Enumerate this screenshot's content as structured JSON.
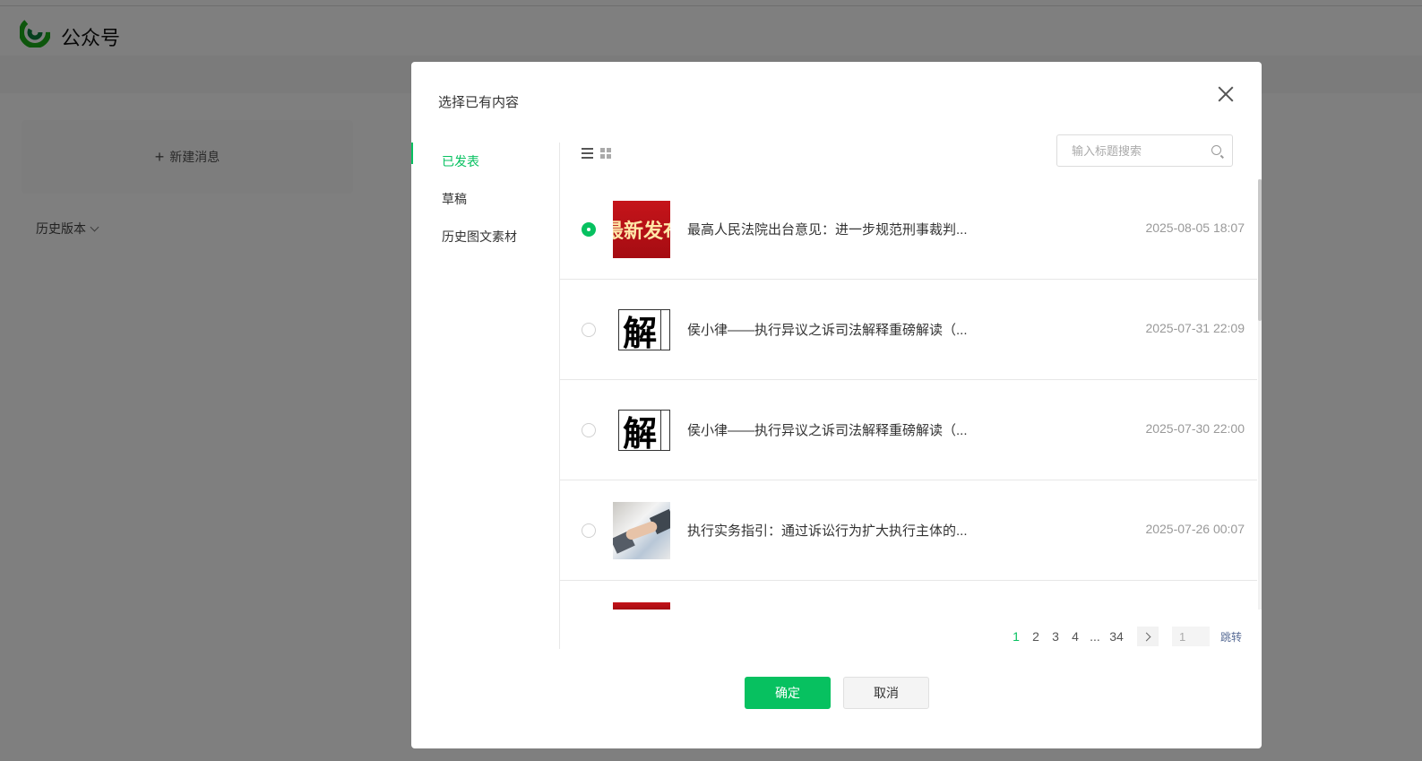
{
  "app": {
    "title": "公众号",
    "new_message": "新建消息",
    "history_version": "历史版本"
  },
  "modal": {
    "title": "选择已有内容",
    "tabs": [
      {
        "label": "已发表",
        "active": true
      },
      {
        "label": "草稿",
        "active": false
      },
      {
        "label": "历史图文素材",
        "active": false
      }
    ],
    "search_placeholder": "输入标题搜索",
    "articles": [
      {
        "title": "最高人民法院出台意见：进一步规范刑事裁判...",
        "date": "2025-08-05 18:07",
        "selected": true,
        "thumb_text": "最新发布"
      },
      {
        "title": "侯小律——执行异议之诉司法解释重磅解读（...",
        "date": "2025-07-31 22:09",
        "selected": false,
        "thumb_text": "解"
      },
      {
        "title": "侯小律——执行异议之诉司法解释重磅解读（...",
        "date": "2025-07-30 22:00",
        "selected": false,
        "thumb_text": "解"
      },
      {
        "title": "执行实务指引：通过诉讼行为扩大执行主体的...",
        "date": "2025-07-26 00:07",
        "selected": false,
        "thumb_text": ""
      }
    ],
    "pagination": {
      "pages": [
        "1",
        "2",
        "3",
        "4",
        "...",
        "34"
      ],
      "current": "1",
      "input_value": "1",
      "jump_label": "跳转"
    },
    "confirm_label": "确定",
    "cancel_label": "取消"
  },
  "colors": {
    "accent": "#07c160",
    "link": "#576b95"
  }
}
